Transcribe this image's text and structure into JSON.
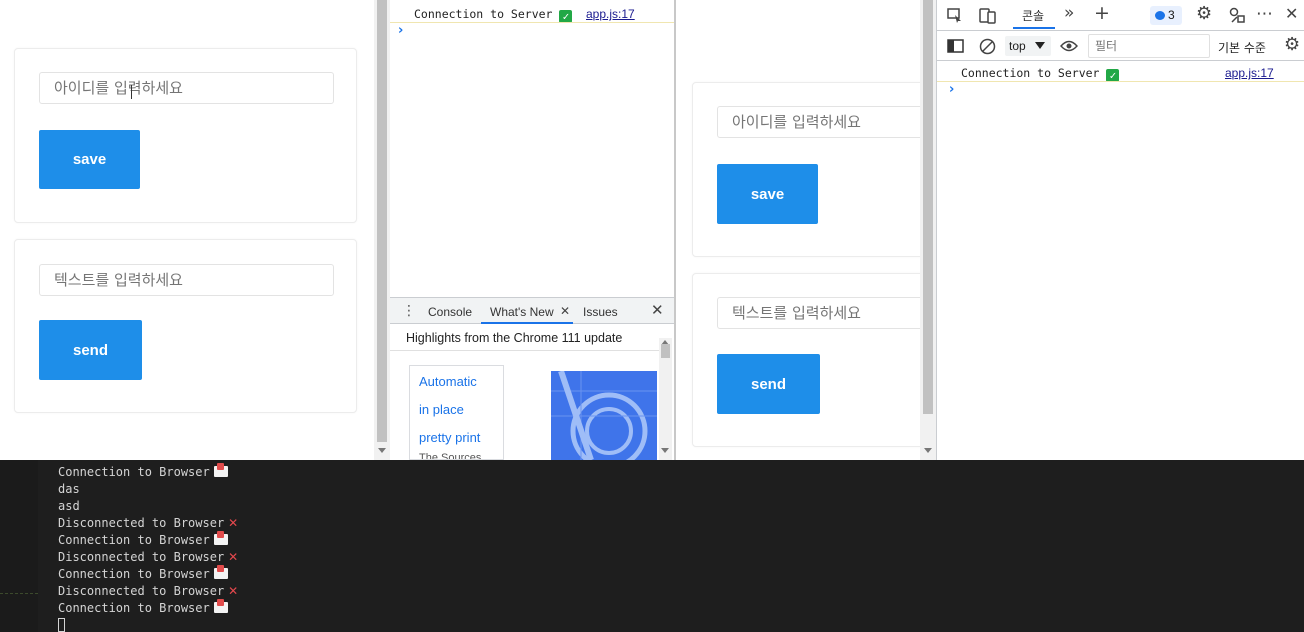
{
  "left_app": {
    "id_placeholder": "아이디를 입력하세요",
    "save_label": "save",
    "text_placeholder": "텍스트를 입력하세요",
    "send_label": "send"
  },
  "devtools_left": {
    "console_message": "Connection to Server",
    "console_source": "app.js:17",
    "prompt": "›",
    "drawer_tabs": [
      "Console",
      "What's New",
      "Issues"
    ],
    "whats_new_heading": "Highlights from the Chrome 111 update",
    "card_lines": [
      "Automatic",
      "in place",
      "pretty print",
      "The Sources"
    ]
  },
  "right_app": {
    "id_placeholder": "아이디를 입력하세요",
    "save_label": "save",
    "text_placeholder": "텍스트를 입력하세요",
    "send_label": "send"
  },
  "devtools_right": {
    "console_tab": "콘솔",
    "issues_count": "3",
    "context": "top",
    "filter_placeholder": "필터",
    "level": "기본 수준",
    "console_message": "Connection to Server",
    "console_source": "app.js:17",
    "prompt": "›"
  },
  "terminal": {
    "lines": [
      {
        "text": "Connection to Browser",
        "icon": "mail"
      },
      {
        "text": "das",
        "icon": ""
      },
      {
        "text": "asd",
        "icon": ""
      },
      {
        "text": "Disconnected to Browser",
        "icon": "x"
      },
      {
        "text": "Connection to Browser",
        "icon": "mail"
      },
      {
        "text": "Disconnected to Browser",
        "icon": "x"
      },
      {
        "text": "Connection to Browser",
        "icon": "mail"
      },
      {
        "text": "Disconnected to Browser",
        "icon": "x"
      },
      {
        "text": "Connection to Browser",
        "icon": "mail"
      }
    ]
  }
}
